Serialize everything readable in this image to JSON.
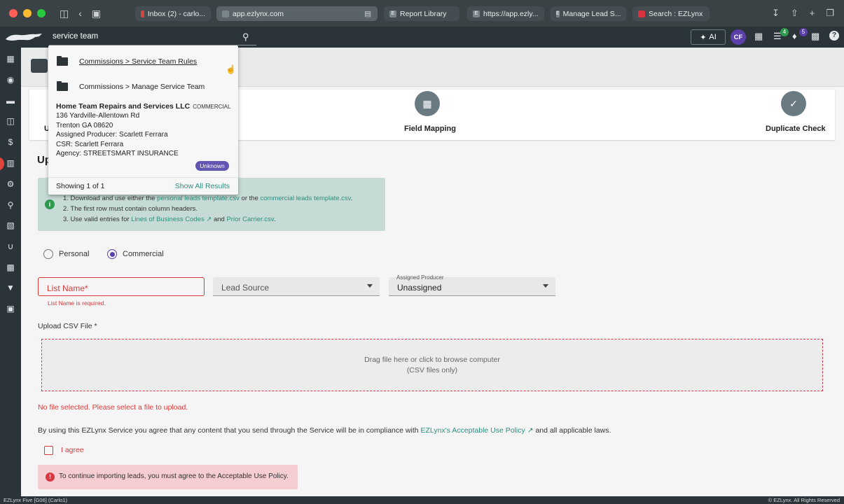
{
  "browser": {
    "tabs": [
      {
        "label": "Inbox (2) - carlo...",
        "favicon": "gmail-icon"
      },
      {
        "label": "app.ezlynx.com",
        "favicon": "ezlynx-icon",
        "active": true
      },
      {
        "label": "Report Library",
        "favicon": "e-icon"
      },
      {
        "label": "https://app.ezly...",
        "favicon": "e-icon"
      },
      {
        "label": "Manage Lead S...",
        "favicon": "e-icon"
      },
      {
        "label": "Search : EZLynx",
        "favicon": "ezlynx-icon"
      }
    ]
  },
  "header": {
    "search_value": "service team",
    "ai_label": "AI",
    "avatar_initials": "CF",
    "tasks_badge": "4",
    "notifications_badge": "5"
  },
  "dropdown": {
    "items": [
      {
        "label": "Commissions > Service Team Rules"
      },
      {
        "label": "Commissions > Manage Service Team"
      }
    ],
    "company": {
      "name": "Home Team Repairs and Services LLC",
      "type": "COMMERCIAL",
      "address1": "136 Yardville-Allentown Rd",
      "address2": "Trenton GA 08620",
      "producer": "Assigned Producer: Scarlett Ferrara",
      "csr": "CSR: Scarlett Ferrara",
      "agency": "Agency: STREETSMART INSURANCE",
      "status": "Unknown"
    },
    "footer_count": "Showing 1 of 1",
    "footer_link": "Show All Results"
  },
  "stepper": {
    "steps": [
      {
        "label": "U"
      },
      {
        "label": "Field Mapping"
      },
      {
        "label": "Duplicate Check"
      }
    ]
  },
  "page": {
    "heading": "Up",
    "info": {
      "l1_pre": "1. Download and use either the",
      "l1_link1": "personal leads template.csv",
      "l1_mid": "or the",
      "l1_link2": "commercial leads template.csv",
      "l1_end": ".",
      "l2": "2. The first row must contain column headers.",
      "l3_pre": "3. Use valid entries for",
      "l3_link1": "Lines of Business Codes",
      "l3_mid": "and",
      "l3_link2": "Prior Carrier.csv",
      "l3_end": "."
    },
    "radio_personal": "Personal",
    "radio_commercial": "Commercial",
    "list_name_label": "List Name*",
    "list_name_error": "List Name is required.",
    "lead_source_label": "Lead Source",
    "producer_tiny": "Assigned Producer",
    "producer_value": "Unassigned",
    "upload_label": "Upload CSV File *",
    "drop_line1": "Drag file here or click to browse computer",
    "drop_line2": "(CSV files only)",
    "no_file": "No file selected. Please select a file to upload.",
    "agree_pre": "By using this EZLynx Service you agree that any content that you send through the Service will be in compliance with",
    "agree_link": "EZLynx's Acceptable Use Policy",
    "agree_post": "and all applicable laws.",
    "i_agree": "I agree",
    "error_banner": "To continue importing leads, you must agree to the Acceptable Use Policy."
  },
  "status": {
    "left": "EZLynx Five [G06] (Carlo1)",
    "right": "© EZLynx. All Rights Reserved"
  }
}
